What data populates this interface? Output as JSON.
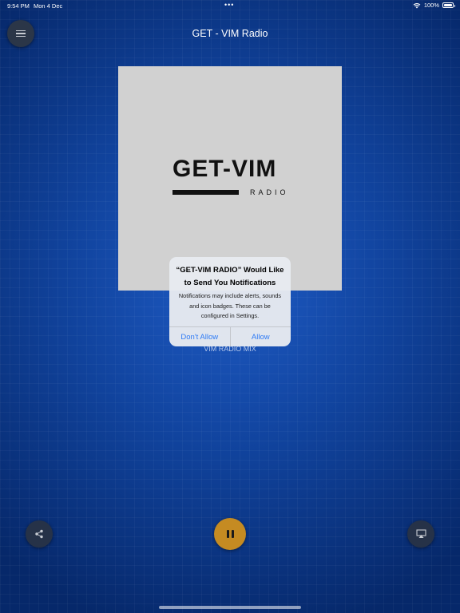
{
  "status_bar": {
    "time": "9:54 PM",
    "date": "Mon 4 Dec",
    "dots": "•••",
    "battery": "100%"
  },
  "header": {
    "title": "GET - VIM Radio",
    "menu_icon": "hamburger-menu-icon"
  },
  "artwork": {
    "logo_main": "GET-VIM",
    "logo_sub": "RADIO"
  },
  "now_playing": {
    "track": "VIM RADIO MIX"
  },
  "alert": {
    "title": "“GET-VIM RADIO” Would Like to Send You Notifications",
    "message": "Notifications may include alerts, sounds and icon badges. These can be configured in Settings.",
    "deny_label": "Don't Allow",
    "allow_label": "Allow"
  },
  "controls": {
    "share_icon": "share-icon",
    "playback_icon": "pause-icon",
    "airplay_icon": "airplay-icon"
  },
  "colors": {
    "background": "#11449f",
    "accent_gold": "#c58b22",
    "alert_button": "#2f7bf5"
  }
}
